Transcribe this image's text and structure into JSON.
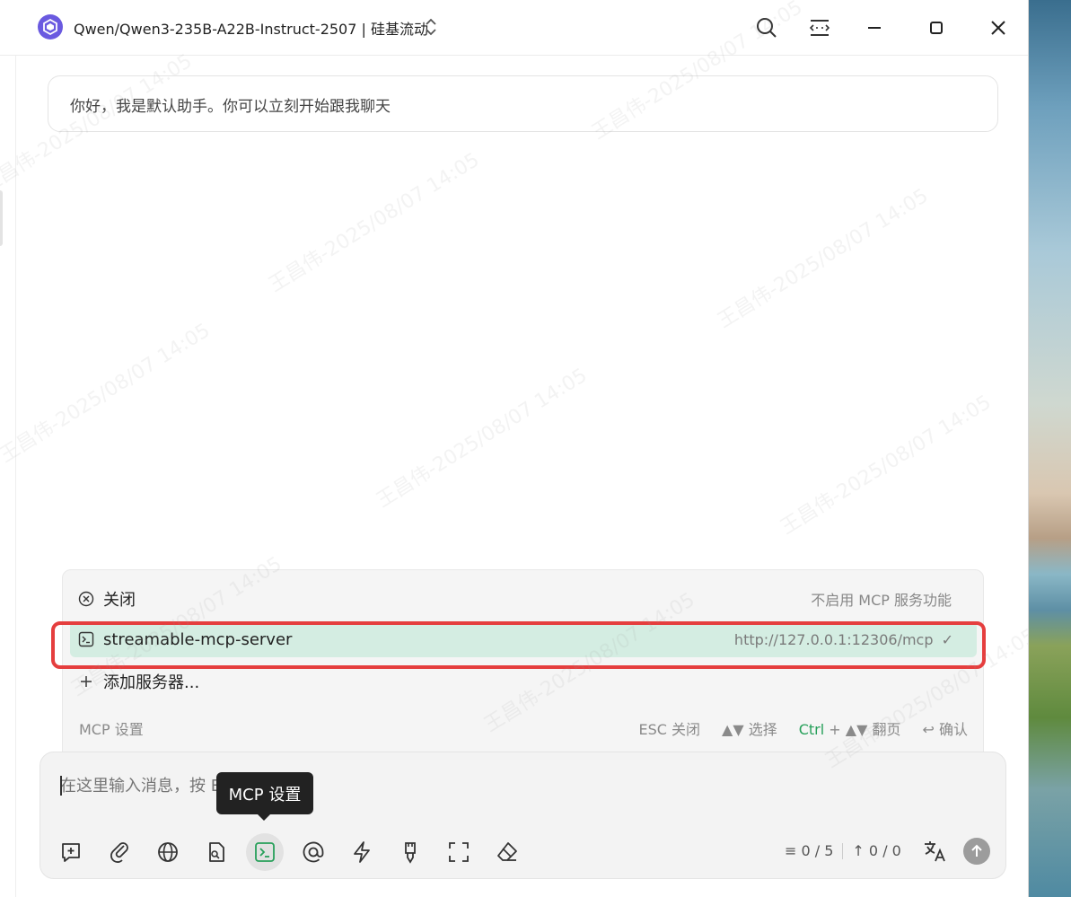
{
  "window": {
    "model_title": "Qwen/Qwen3-235B-A22B-Instruct-2507 | 硅基流动"
  },
  "chat": {
    "greeting": "你好，我是默认助手。你可以立刻开始跟我聊天"
  },
  "mcp_menu": {
    "close_label": "关闭",
    "close_hint": "不启用 MCP 服务功能",
    "server_name": "streamable-mcp-server",
    "server_url": "http://127.0.0.1:12306/mcp",
    "server_selected": true,
    "add_label": "添加服务器...",
    "footer_title": "MCP 设置",
    "hint_esc": "ESC 关闭",
    "hint_select": "▲▼ 选择",
    "hint_ctrl": "Ctrl",
    "hint_page": "+ ▲▼ 翻页",
    "hint_confirm": "↩ 确认"
  },
  "input": {
    "placeholder": "在这里输入消息，按 Enter 发送...",
    "tooltip": "MCP 设置",
    "context_count": "0 / 5",
    "token_count": "0 / 0"
  },
  "toolbar_icons": [
    "new-topic-icon",
    "attachment-icon",
    "web-search-icon",
    "knowledge-icon",
    "mcp-icon",
    "mention-icon",
    "quick-phrase-icon",
    "clear-format-icon",
    "fullscreen-icon",
    "eraser-icon"
  ],
  "watermark": "王昌伟-2025/08/07 14:05",
  "colors": {
    "accent_green": "#27a05a",
    "selected_row": "#d4ede2",
    "highlight_red": "#e53e3e",
    "logo_purple": "#6a5ae0"
  }
}
